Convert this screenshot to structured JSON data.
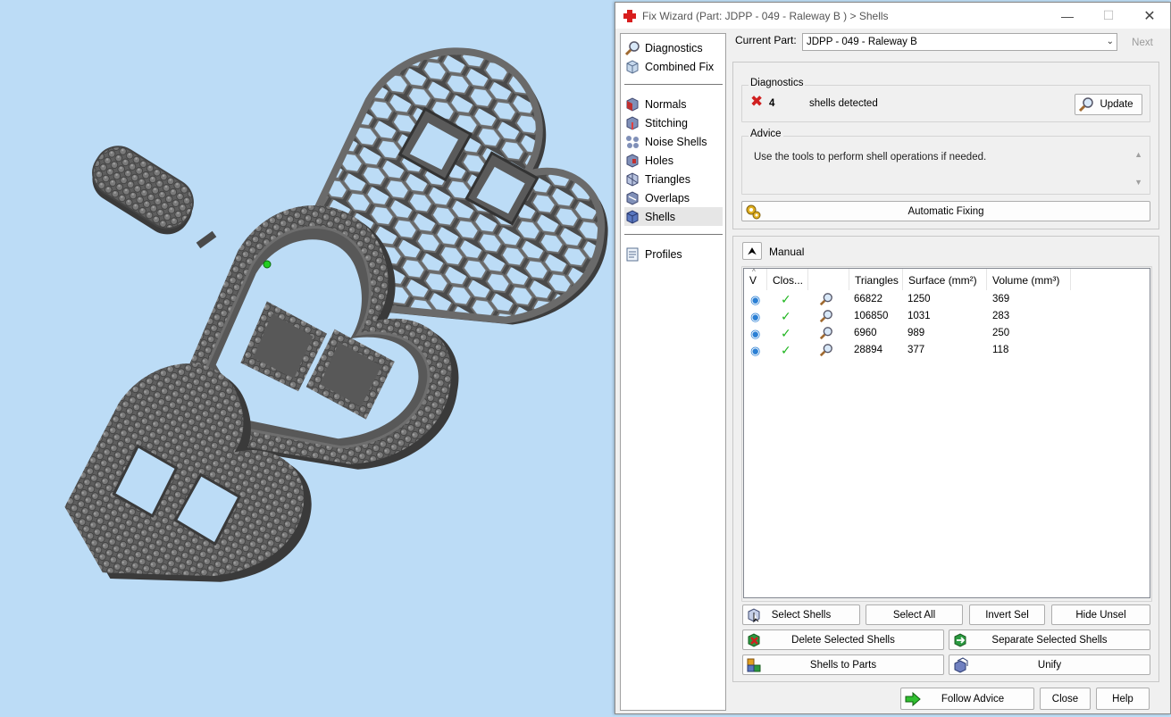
{
  "window": {
    "title": "Fix Wizard (Part: JDPP - 049 - Raleway B ) > Shells"
  },
  "nav": {
    "items_top": [
      {
        "label": "Diagnostics",
        "icon": "magnifier-icon"
      },
      {
        "label": "Combined Fix",
        "icon": "combined-fix-icon"
      }
    ],
    "items_mid": [
      {
        "label": "Normals",
        "icon": "normals-icon"
      },
      {
        "label": "Stitching",
        "icon": "stitching-icon"
      },
      {
        "label": "Noise Shells",
        "icon": "noise-shells-icon"
      },
      {
        "label": "Holes",
        "icon": "holes-icon"
      },
      {
        "label": "Triangles",
        "icon": "triangles-icon"
      },
      {
        "label": "Overlaps",
        "icon": "overlaps-icon"
      },
      {
        "label": "Shells",
        "icon": "shells-icon",
        "active": true
      }
    ],
    "items_bottom": [
      {
        "label": "Profiles",
        "icon": "profiles-icon"
      }
    ]
  },
  "header": {
    "current_part_label": "Current Part:",
    "current_part_value": "JDPP - 049 - Raleway B",
    "next_label": "Next"
  },
  "diagnostics": {
    "title": "Diagnostics",
    "count": "4",
    "message": "shells detected",
    "update_label": "Update"
  },
  "advice": {
    "title": "Advice",
    "text": "Use the tools to perform shell operations if needed."
  },
  "auto_fix_label": "Automatic Fixing",
  "manual": {
    "title": "Manual",
    "collapse_symbol": "⮝"
  },
  "table": {
    "columns": [
      "V",
      "Clos...",
      "",
      "Triangles",
      "Surface (mm²)",
      "Volume (mm³)"
    ],
    "rows": [
      {
        "triangles": "66822",
        "surface": "1250",
        "volume": "369"
      },
      {
        "triangles": "106850",
        "surface": "1031",
        "volume": "283"
      },
      {
        "triangles": "6960",
        "surface": "989",
        "volume": "250"
      },
      {
        "triangles": "28894",
        "surface": "377",
        "volume": "118"
      }
    ]
  },
  "actions": {
    "select_shells": "Select Shells",
    "select_all": "Select All",
    "invert_sel": "Invert Sel",
    "hide_unsel": "Hide Unsel",
    "delete_selected": "Delete Selected Shells",
    "separate_selected": "Separate Selected Shells",
    "shells_to_parts": "Shells to Parts",
    "unify": "Unify"
  },
  "footer": {
    "follow_advice": "Follow Advice",
    "close": "Close",
    "help": "Help"
  },
  "colors": {
    "viewport_bg": "#bcdcf6",
    "model_gray": "#5a5a5a",
    "error_red": "#d02020",
    "check_green": "#1fb51f",
    "eye_blue": "#2a7fd4"
  }
}
